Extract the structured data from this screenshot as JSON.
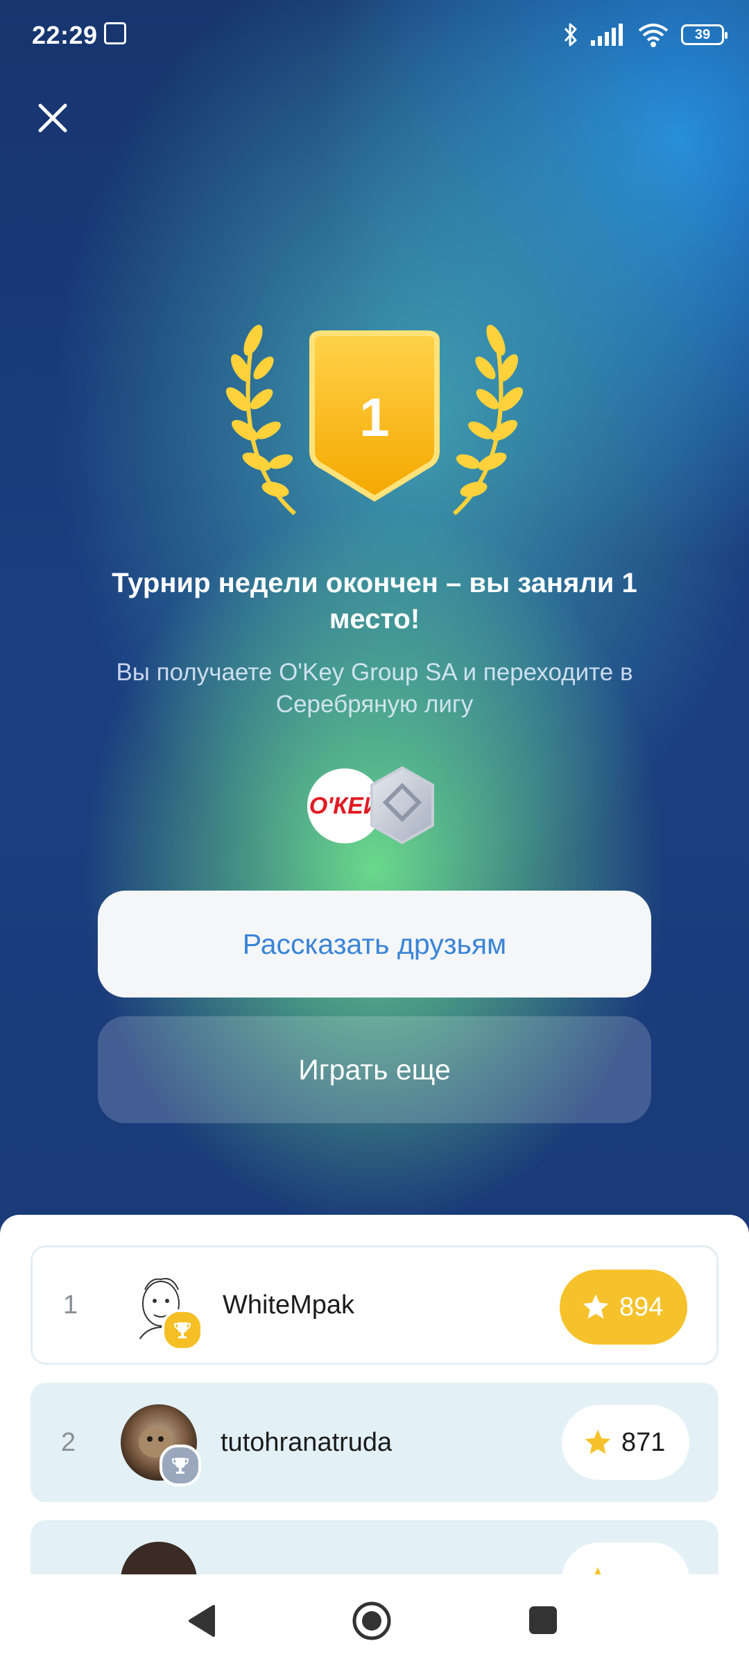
{
  "status_bar": {
    "time": "22:29",
    "battery_level": "39"
  },
  "achievement": {
    "place_number": "1",
    "title": "Турнир недели окончен – вы заняли 1 место!",
    "subtitle": "Вы получаете O'Key Group SA и переходите в Серебряную лигу",
    "reward_logo_text": "О'КЕЙ",
    "league_badge_icon": "silver-league-icon"
  },
  "buttons": {
    "share_label": "Рассказать друзьям",
    "play_label": "Играть еще"
  },
  "leaderboard": {
    "rows": [
      {
        "rank": "1",
        "name": "WhiteMpak",
        "score": "894",
        "trophy": "gold"
      },
      {
        "rank": "2",
        "name": "tutohranatruda",
        "score": "871",
        "trophy": "silver"
      }
    ]
  },
  "colors": {
    "accent_blue": "#3a84d6",
    "gold": "#f6c22c",
    "silver": "#9aa7bd"
  }
}
